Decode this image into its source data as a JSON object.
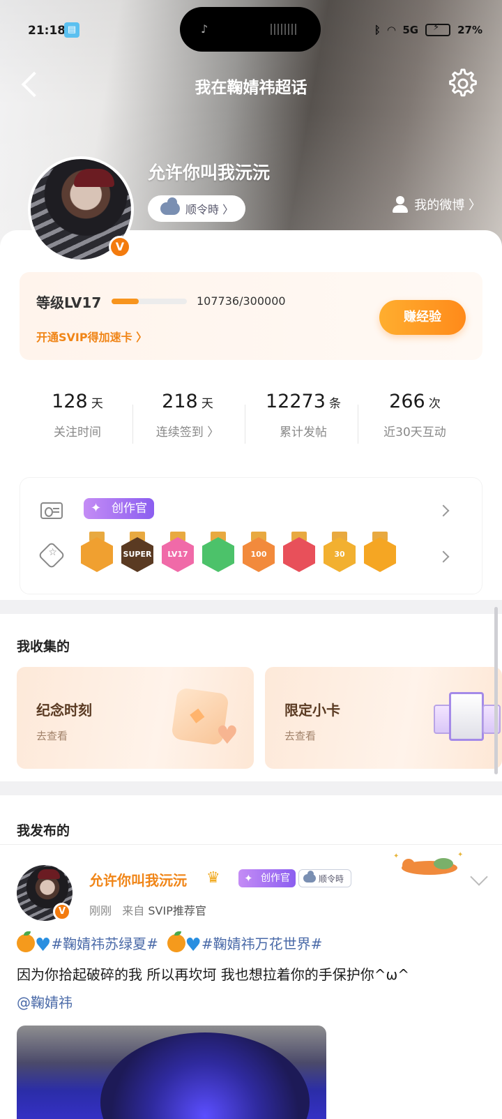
{
  "status_bar": {
    "time": "21:18",
    "network": "5G",
    "battery": "27%"
  },
  "nav": {
    "title": "我在鞠婧祎超话"
  },
  "profile": {
    "username": "允许你叫我沅沅",
    "verified_mark": "V",
    "tag_label": "顺令時 〉",
    "my_weibo": "我的微博 〉"
  },
  "level": {
    "label": "等级LV17",
    "progress_text": "107736/300000",
    "progress_fraction": 0.36,
    "svip_link": "开通SVIP得加速卡 〉",
    "earn_button": "赚经验"
  },
  "stats": [
    {
      "num": "128",
      "unit": "天",
      "label": "关注时间"
    },
    {
      "num": "218",
      "unit": "天",
      "label": "连续签到 〉"
    },
    {
      "num": "12273",
      "unit": "条",
      "label": "累计发帖"
    },
    {
      "num": "266",
      "unit": "次",
      "label": "近30天互动"
    }
  ],
  "badges": {
    "creator_label": "创作官",
    "medals": [
      {
        "text": "",
        "color": "#f0a030"
      },
      {
        "text": "SUPER",
        "color": "#5a3a22"
      },
      {
        "text": "LV17",
        "color": "#f06aa8"
      },
      {
        "text": "",
        "color": "#4cc26a"
      },
      {
        "text": "100",
        "color": "#f28a3c"
      },
      {
        "text": "",
        "color": "#e8505a"
      },
      {
        "text": "30",
        "color": "#f2b030"
      },
      {
        "text": "",
        "color": "#f5a623"
      }
    ]
  },
  "collect": {
    "title": "我收集的",
    "cards": [
      {
        "title": "纪念时刻",
        "sub": "去查看"
      },
      {
        "title": "限定小卡",
        "sub": "去查看"
      }
    ]
  },
  "posts": {
    "title": "我发布的",
    "item": {
      "author": "允许你叫我沅沅",
      "creator_label": "创作官",
      "tag_label": "顺令時",
      "time": "刚刚",
      "source_prefix": "来自",
      "source": "SVIP推荐官",
      "hashtag1": "#鞠婧祎苏绿夏#",
      "hashtag2": "#鞠婧祎万花世界#",
      "body": "因为你拾起破碎的我 所以再坎坷 我也想拉着你的手保护你^ω^",
      "mention": "@鞠婧祎"
    }
  }
}
